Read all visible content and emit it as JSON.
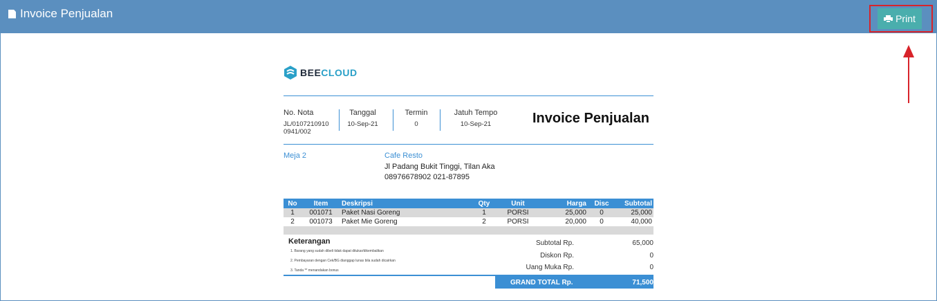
{
  "header": {
    "title": "Invoice Penjualan",
    "print_label": "Print"
  },
  "invoice": {
    "logo": {
      "part1": "BEE",
      "part2": "CLOUD"
    },
    "title": "Invoice Penjualan",
    "meta": {
      "no_nota_label": "No. Nota",
      "no_nota_value": "JL/0107210910 0941/002",
      "tanggal_label": "Tanggal",
      "tanggal_value": "10-Sep-21",
      "termin_label": "Termin",
      "termin_value": "0",
      "jatuh_tempo_label": "Jatuh Tempo",
      "jatuh_tempo_value": "10-Sep-21"
    },
    "customer": "Meja 2",
    "seller": {
      "name": "Cafe Resto",
      "address": "Jl Padang Bukit Tinggi, Tilan Aka",
      "phone": "08976678902 021-87895"
    },
    "table": {
      "headers": [
        "No",
        "Item",
        "Deskripsi",
        "Qty",
        "Unit",
        "Harga",
        "Disc",
        "Subtotal"
      ],
      "rows": [
        [
          "1",
          "001071",
          "Paket Nasi Goreng",
          "1",
          "PORSI",
          "25,000",
          "0",
          "25,000"
        ],
        [
          "2",
          "001073",
          "Paket Mie Goreng",
          "2",
          "PORSI",
          "20,000",
          "0",
          "40,000"
        ]
      ]
    },
    "notes": {
      "title": "Keterangan",
      "lines": [
        "1. Barang yang sudah dibeli tidak dapat ditukar/dikembalikan",
        "2. Pembayaran dengan Cek/BG dianggap lunas bila sudah dicairkan",
        "3. Tanda ** menandakan bonus"
      ]
    },
    "totals": {
      "subtotal_label": "Subtotal Rp.",
      "subtotal_value": "65,000",
      "diskon_label": "Diskon Rp.",
      "diskon_value": "0",
      "uang_muka_label": "Uang Muka Rp.",
      "uang_muka_value": "0",
      "grand_label": "GRAND TOTAL Rp.",
      "grand_value": "71,500"
    }
  },
  "colors": {
    "header_bg": "#5b8fbf",
    "print_btn": "#4aaead",
    "accent_blue": "#3b8fd4",
    "annotation_red": "#d8232a"
  }
}
